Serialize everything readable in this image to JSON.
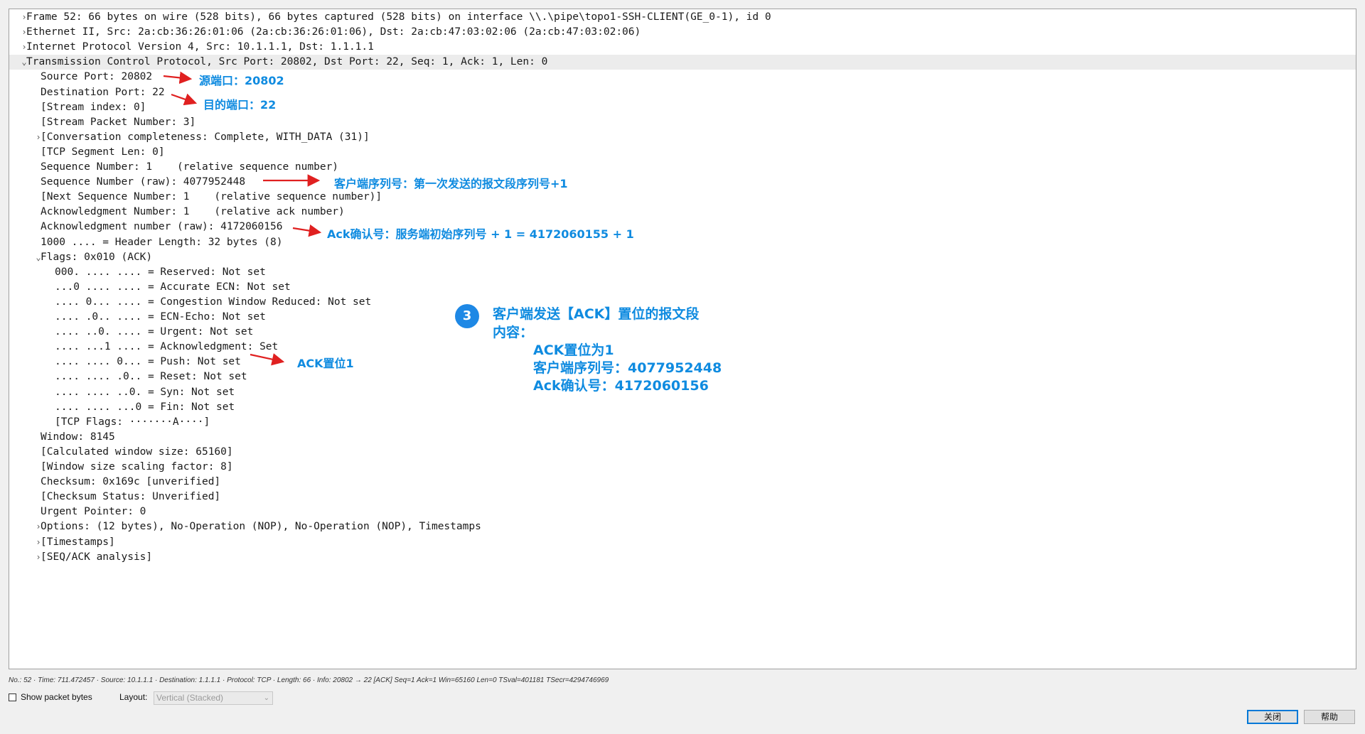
{
  "tree_rows": [
    {
      "arrow": "collapsed",
      "text": "Frame 52: 66 bytes on wire (528 bits), 66 bytes captured (528 bits) on interface \\\\.\\pipe\\topo1-SSH-CLIENT(GE_0-1), id 0"
    },
    {
      "arrow": "collapsed",
      "text": "Ethernet II, Src: 2a:cb:36:26:01:06 (2a:cb:36:26:01:06), Dst: 2a:cb:47:03:02:06 (2a:cb:47:03:02:06)"
    },
    {
      "arrow": "collapsed",
      "text": "Internet Protocol Version 4, Src: 10.1.1.1, Dst: 1.1.1.1"
    },
    {
      "arrow": "expanded",
      "text": "Transmission Control Protocol, Src Port: 20802, Dst Port: 22, Seq: 1, Ack: 1, Len: 0",
      "selected": true
    },
    {
      "text": "Source Port: 20802"
    },
    {
      "text": "Destination Port: 22"
    },
    {
      "text": "[Stream index: 0]"
    },
    {
      "text": "[Stream Packet Number: 3]"
    },
    {
      "arrow": "collapsed",
      "text": "[Conversation completeness: Complete, WITH_DATA (31)]"
    },
    {
      "text": "[TCP Segment Len: 0]"
    },
    {
      "text": "Sequence Number: 1    (relative sequence number)"
    },
    {
      "text": "Sequence Number (raw): 4077952448"
    },
    {
      "text": "[Next Sequence Number: 1    (relative sequence number)]"
    },
    {
      "text": "Acknowledgment Number: 1    (relative ack number)"
    },
    {
      "text": "Acknowledgment number (raw): 4172060156"
    },
    {
      "text": "1000 .... = Header Length: 32 bytes (8)"
    },
    {
      "arrow": "expanded",
      "text": "Flags: 0x010 (ACK)"
    },
    {
      "text": "000. .... .... = Reserved: Not set",
      "indent": 2
    },
    {
      "text": "...0 .... .... = Accurate ECN: Not set",
      "indent": 2
    },
    {
      "text": ".... 0... .... = Congestion Window Reduced: Not set",
      "indent": 2
    },
    {
      "text": ".... .0.. .... = ECN-Echo: Not set",
      "indent": 2
    },
    {
      "text": ".... ..0. .... = Urgent: Not set",
      "indent": 2
    },
    {
      "text": ".... ...1 .... = Acknowledgment: Set",
      "indent": 2
    },
    {
      "text": ".... .... 0... = Push: Not set",
      "indent": 2
    },
    {
      "text": ".... .... .0.. = Reset: Not set",
      "indent": 2
    },
    {
      "text": ".... .... ..0. = Syn: Not set",
      "indent": 2
    },
    {
      "text": ".... .... ...0 = Fin: Not set",
      "indent": 2
    },
    {
      "text": "[TCP Flags: ·······A····]",
      "indent": 2
    },
    {
      "text": "Window: 8145"
    },
    {
      "text": "[Calculated window size: 65160]"
    },
    {
      "text": "[Window size scaling factor: 8]"
    },
    {
      "text": "Checksum: 0x169c [unverified]"
    },
    {
      "text": "[Checksum Status: Unverified]"
    },
    {
      "text": "Urgent Pointer: 0"
    },
    {
      "arrow": "collapsed",
      "text": "Options: (12 bytes), No-Operation (NOP), No-Operation (NOP), Timestamps"
    },
    {
      "arrow": "collapsed",
      "text": "[Timestamps]"
    },
    {
      "arrow": "collapsed",
      "text": "[SEQ/ACK analysis]"
    }
  ],
  "annotations": {
    "source_port": "源端口：20802",
    "dest_port": "目的端口：22",
    "client_seq": "客户端序列号：第一次发送的报文段序列号+1",
    "ack_number": "Ack确认号：服务端初始序列号 + 1 = 4172060155 + 1",
    "ack_flag": "ACK置位1",
    "step_badge": "3",
    "summary_line1": "客户端发送【ACK】置位的报文段",
    "summary_line2": "内容：",
    "summary_line3": "ACK置位为1",
    "summary_line4": "客户端序列号：4077952448",
    "summary_line5": "Ack确认号：4172060156",
    "annotation_color": "#0f8be0",
    "arrow_color": "#e02020"
  },
  "status": "No.: 52 · Time: 711.472457 · Source: 10.1.1.1 · Destination: 1.1.1.1 · Protocol: TCP · Length: 66 · Info: 20802 → 22 [ACK] Seq=1 Ack=1 Win=65160 Len=0 TSval=401181 TSecr=4294746969",
  "bottom": {
    "show_bytes_label": "Show packet bytes",
    "show_bytes_checked": false,
    "layout_label": "Layout:",
    "layout_value": "Vertical (Stacked)"
  },
  "buttons": {
    "close": "关闭",
    "help": "帮助"
  }
}
